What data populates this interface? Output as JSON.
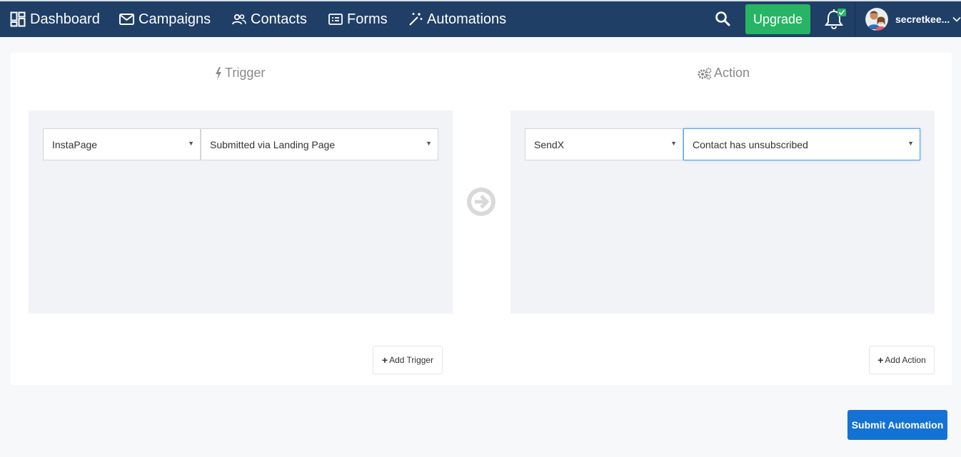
{
  "nav": {
    "dashboard": "Dashboard",
    "campaigns": "Campaigns",
    "contacts": "Contacts",
    "forms": "Forms",
    "automations": "Automations",
    "upgrade": "Upgrade",
    "username": "secretkee..."
  },
  "icons": {
    "dashboard": "dashboard-grid-icon",
    "campaigns": "envelope-icon",
    "contacts": "users-icon",
    "forms": "form-icon",
    "automations": "magic-wand-icon",
    "search": "search-icon",
    "notifications": "bell-icon",
    "notification_badge": "check-badge-icon",
    "trigger": "bolt-icon",
    "action": "gears-icon",
    "flow": "arrow-right-circle-icon"
  },
  "trigger": {
    "title": "Trigger",
    "app": "InstaPage",
    "event": "Submitted via Landing Page",
    "add_label": "Add Trigger"
  },
  "action": {
    "title": "Action",
    "app": "SendX",
    "event": "Contact has unsubscribed",
    "add_label": "Add Action"
  },
  "submit_label": "Submit Automation",
  "colors": {
    "topbar": "#1f3f66",
    "upgrade": "#27b565",
    "submit": "#1472d4",
    "badge": "#27b565"
  }
}
